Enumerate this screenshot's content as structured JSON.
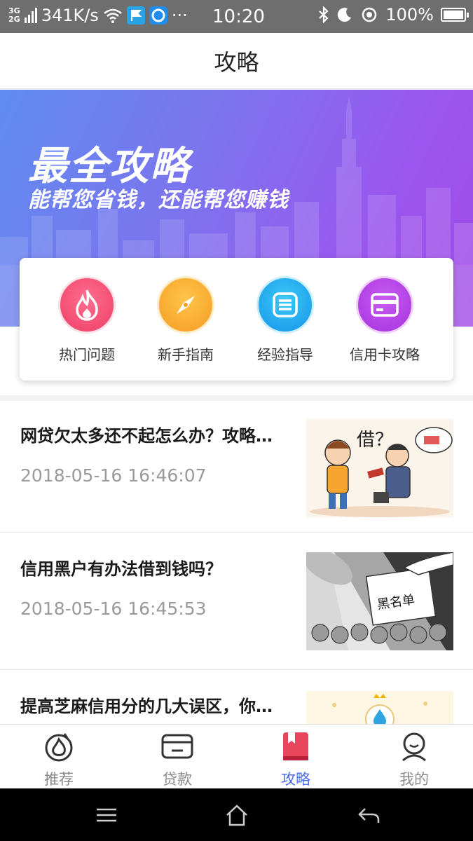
{
  "status_bar": {
    "signal_top": "3G",
    "signal_bottom": "2G",
    "speed": "341K/s",
    "more": "···",
    "time": "10:20",
    "battery": "100%"
  },
  "header": {
    "title": "攻略"
  },
  "banner": {
    "title": "最全攻略",
    "subtitle": "能帮您省钱，还能帮您赚钱"
  },
  "categories": [
    {
      "label": "热门问题",
      "icon": "flame-icon",
      "color": "#f0456f"
    },
    {
      "label": "新手指南",
      "icon": "compass-icon",
      "color": "#f7a531"
    },
    {
      "label": "经验指导",
      "icon": "document-icon",
      "color": "#1ba8f0"
    },
    {
      "label": "信用卡攻略",
      "icon": "credit-card-icon",
      "color": "#b03fe0"
    }
  ],
  "articles": [
    {
      "title": "网贷欠太多还不起怎么办？攻略…",
      "date": "2018-05-16 16:46:07",
      "thumb_text": "借？"
    },
    {
      "title": "信用黑户有办法借到钱吗？",
      "date": "2018-05-16 16:45:53",
      "thumb_text": "黑名单"
    },
    {
      "title": "提高芝麻信用分的几大误区，你…",
      "date": "",
      "thumb_text": ""
    }
  ],
  "tabs": [
    {
      "label": "推荐",
      "icon": "recommend-icon",
      "active": false
    },
    {
      "label": "贷款",
      "icon": "loan-card-icon",
      "active": false
    },
    {
      "label": "攻略",
      "icon": "guide-book-icon",
      "active": true
    },
    {
      "label": "我的",
      "icon": "profile-icon",
      "active": false
    }
  ],
  "colors": {
    "accent": "#4a6df0",
    "active_tab_icon": "#e8465d"
  }
}
